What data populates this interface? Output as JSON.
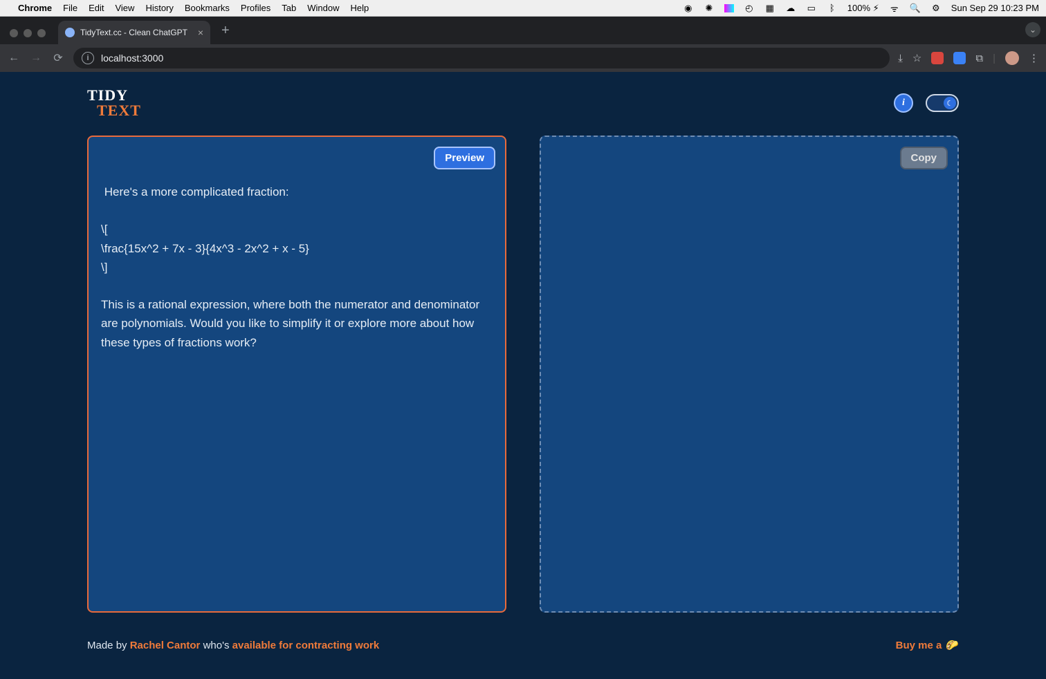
{
  "mac_menu": {
    "app": "Chrome",
    "items": [
      "File",
      "Edit",
      "View",
      "History",
      "Bookmarks",
      "Profiles",
      "Tab",
      "Window",
      "Help"
    ],
    "battery": "100%",
    "clock": "Sun Sep 29  10:23 PM"
  },
  "browser": {
    "tab_title": "TidyText.cc - Clean ChatGPT",
    "url": "localhost:3000"
  },
  "app": {
    "logo_line1": "TIDY",
    "logo_line2": "TEXT",
    "info_tooltip": "i",
    "preview_button": "Preview",
    "copy_button": "Copy",
    "input_text": " Here's a more complicated fraction:\n\n\\[\n\\frac{15x^2 + 7x - 3}{4x^3 - 2x^2 + x - 5}\n\\]\n\nThis is a rational expression, where both the numerator and denominator are polynomials. Would you like to simplify it or explore more about how these types of fractions work?"
  },
  "footer": {
    "prefix": "Made by ",
    "author": "Rachel Cantor",
    "mid": " who's ",
    "avail": "available for contracting work",
    "buy_label": "Buy me a "
  }
}
